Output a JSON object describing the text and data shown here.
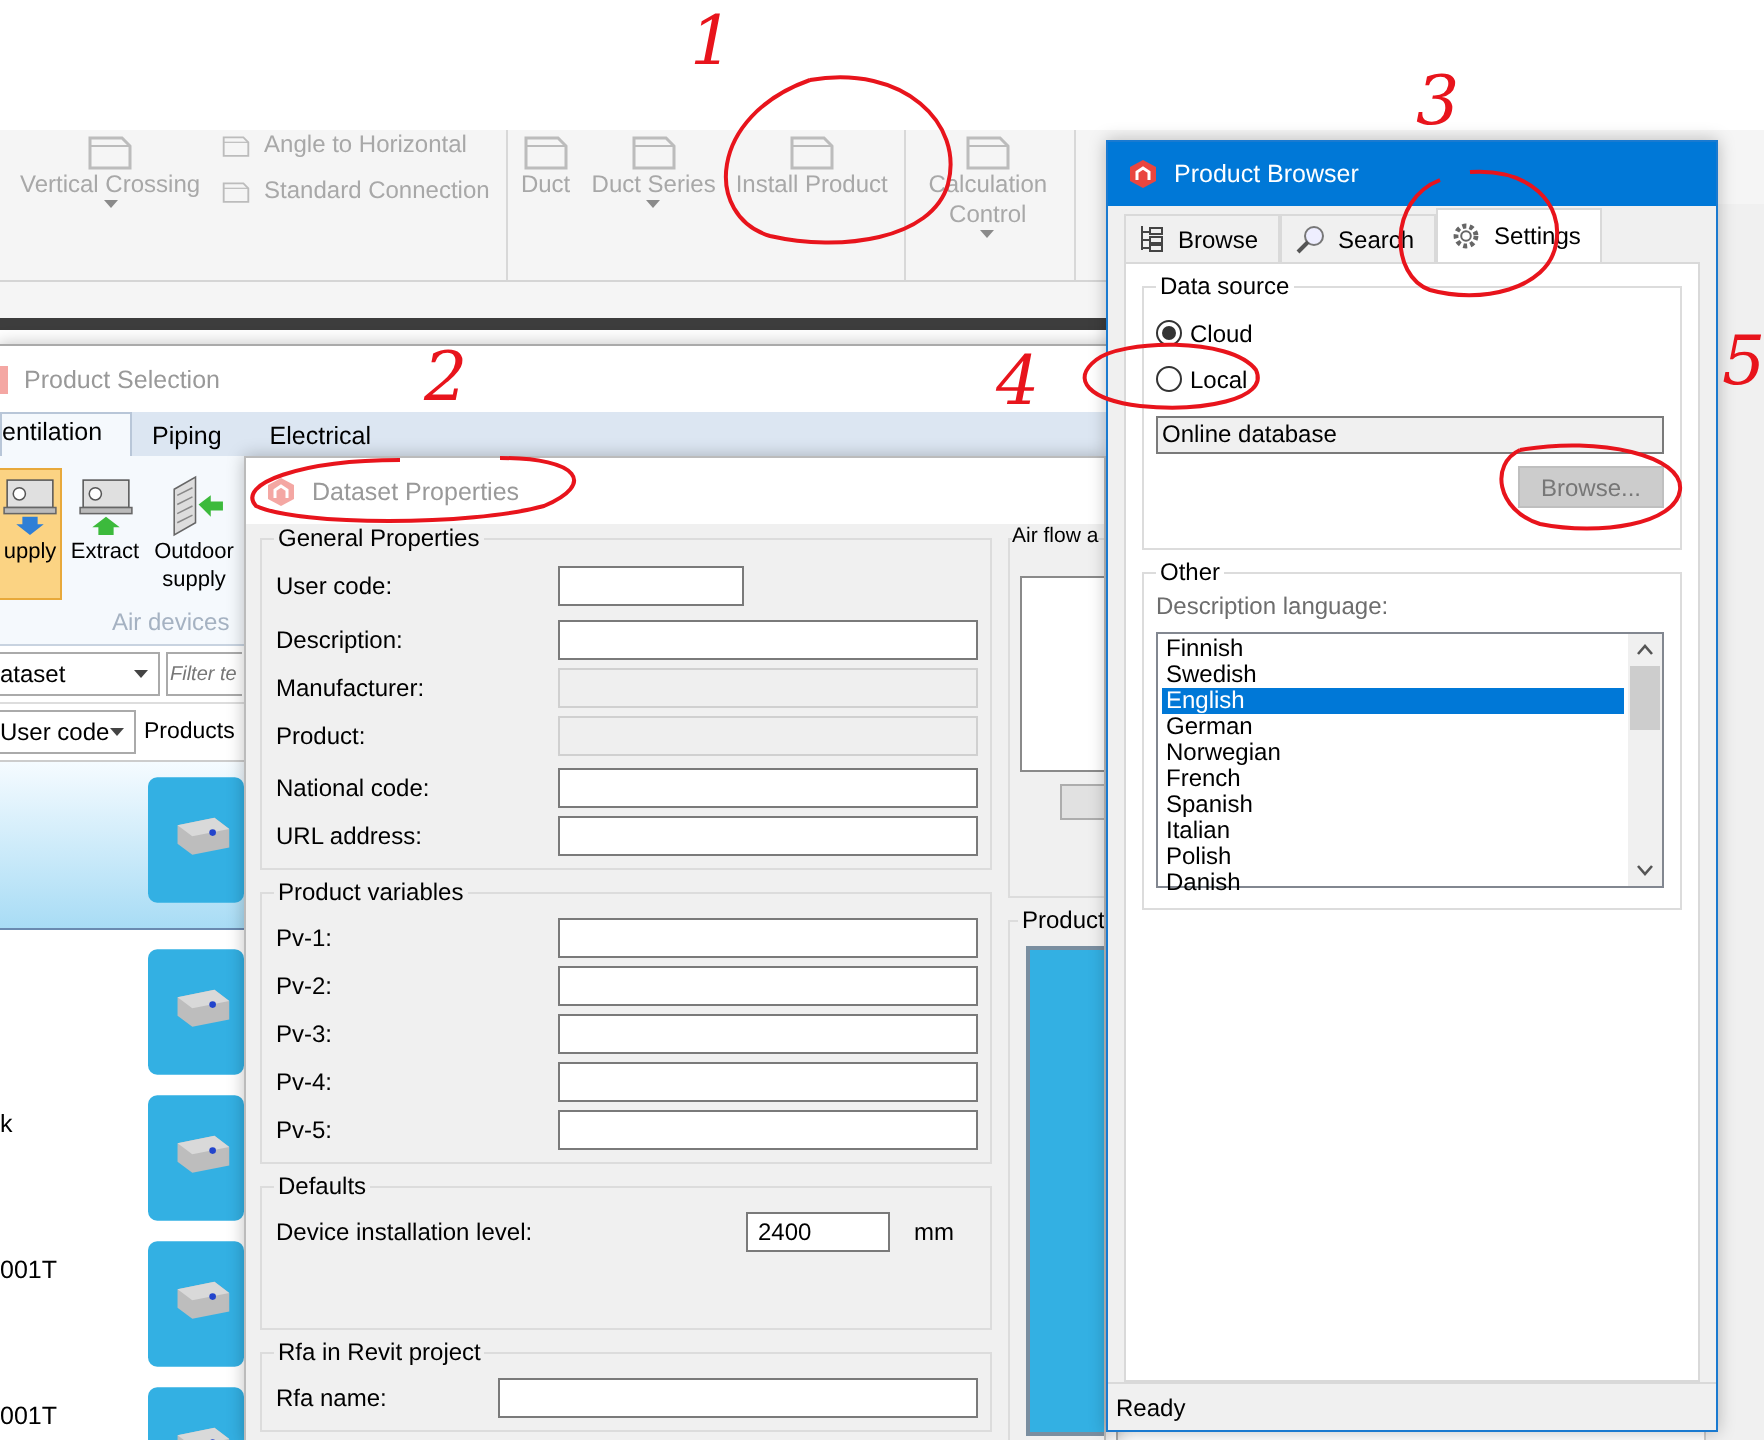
{
  "ribbon": {
    "groups": [
      {
        "items": [
          {
            "kind": "large",
            "label": "Vertical Crossing",
            "dropdown": true,
            "disabled": true
          },
          {
            "kind": "stack",
            "labels": [
              "Angle to  Horizontal",
              "Standard  Connection"
            ],
            "disabled": true
          }
        ]
      },
      {
        "items": [
          {
            "kind": "large",
            "label": "Duct",
            "dropdown": false,
            "disabled": true
          },
          {
            "kind": "large",
            "label": "Duct Series",
            "dropdown": true,
            "disabled": true
          },
          {
            "kind": "large",
            "label": "Install Product",
            "dropdown": false,
            "disabled": true
          }
        ]
      },
      {
        "items": [
          {
            "kind": "large",
            "label": "Calculation Control",
            "dropdown": true,
            "disabled": true
          }
        ]
      }
    ]
  },
  "product_selection": {
    "title": "Product Selection",
    "tabs": [
      {
        "label": "entilation",
        "selected": true
      },
      {
        "label": "Piping",
        "selected": false
      },
      {
        "label": "Electrical",
        "selected": false
      }
    ],
    "tools": [
      {
        "label": "upply",
        "selected": true
      },
      {
        "label": "Extract",
        "selected": false
      },
      {
        "label": "Outdoor supply",
        "selected": false
      }
    ],
    "group_label": "Air devices",
    "dataset_dropdown": "ataset",
    "filter": {
      "placeholder": "Filter te"
    },
    "sort_dropdown": "User code",
    "column_header": "Products",
    "rows": [
      {
        "selected": true
      },
      {
        "selected": false
      },
      {
        "code": "k",
        "selected": false
      },
      {
        "code": "001T",
        "selected": false
      },
      {
        "code": "001T",
        "selected": false
      }
    ]
  },
  "dataset_properties": {
    "title": "Dataset Properties",
    "general": {
      "title": "General Properties",
      "fields": [
        {
          "label": "User code:",
          "kind": "short",
          "disabled": false
        },
        {
          "label": "Description:",
          "kind": "wide",
          "disabled": false
        },
        {
          "label": "Manufacturer:",
          "kind": "wide",
          "disabled": true
        },
        {
          "label": "Product:",
          "kind": "wide",
          "disabled": true
        },
        {
          "label": "National code:",
          "kind": "wide",
          "disabled": false
        },
        {
          "label": "URL address:",
          "kind": "wide",
          "disabled": false
        }
      ]
    },
    "variables": {
      "title": "Product variables",
      "fields": [
        {
          "label": "Pv-1:"
        },
        {
          "label": "Pv-2:"
        },
        {
          "label": "Pv-3:"
        },
        {
          "label": "Pv-4:"
        },
        {
          "label": "Pv-5:"
        }
      ]
    },
    "defaults": {
      "title": "Defaults",
      "label": "Device installation level:",
      "value": "2400",
      "unit": "mm"
    },
    "rfa": {
      "title": "Rfa in Revit project",
      "label": "Rfa name:"
    },
    "air_flow": {
      "title": "Air flow a"
    },
    "product": {
      "title": "Product"
    }
  },
  "product_browser": {
    "title": "Product Browser",
    "tabs": [
      {
        "label": "Browse",
        "kind": "tree",
        "selected": false
      },
      {
        "label": "Search",
        "kind": "search",
        "selected": false
      },
      {
        "label": "Settings",
        "kind": "gear",
        "selected": true
      }
    ],
    "data_source": {
      "title": "Data source",
      "options": [
        {
          "label": "Cloud",
          "selected": true
        },
        {
          "label": "Local",
          "selected": false
        }
      ],
      "path": {
        "value": "Online database",
        "disabled": true
      },
      "browse_button": {
        "label": "Browse...",
        "disabled": true
      }
    },
    "other": {
      "title": "Other",
      "language_label": "Description language:",
      "languages": [
        {
          "label": "Finnish",
          "selected": false
        },
        {
          "label": "Swedish",
          "selected": false
        },
        {
          "label": "English",
          "selected": true
        },
        {
          "label": "German",
          "selected": false
        },
        {
          "label": "Norwegian",
          "selected": false
        },
        {
          "label": "French",
          "selected": false
        },
        {
          "label": "Spanish",
          "selected": false
        },
        {
          "label": "Italian",
          "selected": false
        },
        {
          "label": "Polish",
          "selected": false
        },
        {
          "label": "Danish",
          "selected": false
        }
      ]
    },
    "status": "Ready"
  },
  "annotations": [
    {
      "label": "1"
    },
    {
      "label": "2"
    },
    {
      "label": "3"
    },
    {
      "label": "4"
    },
    {
      "label": "5"
    }
  ]
}
